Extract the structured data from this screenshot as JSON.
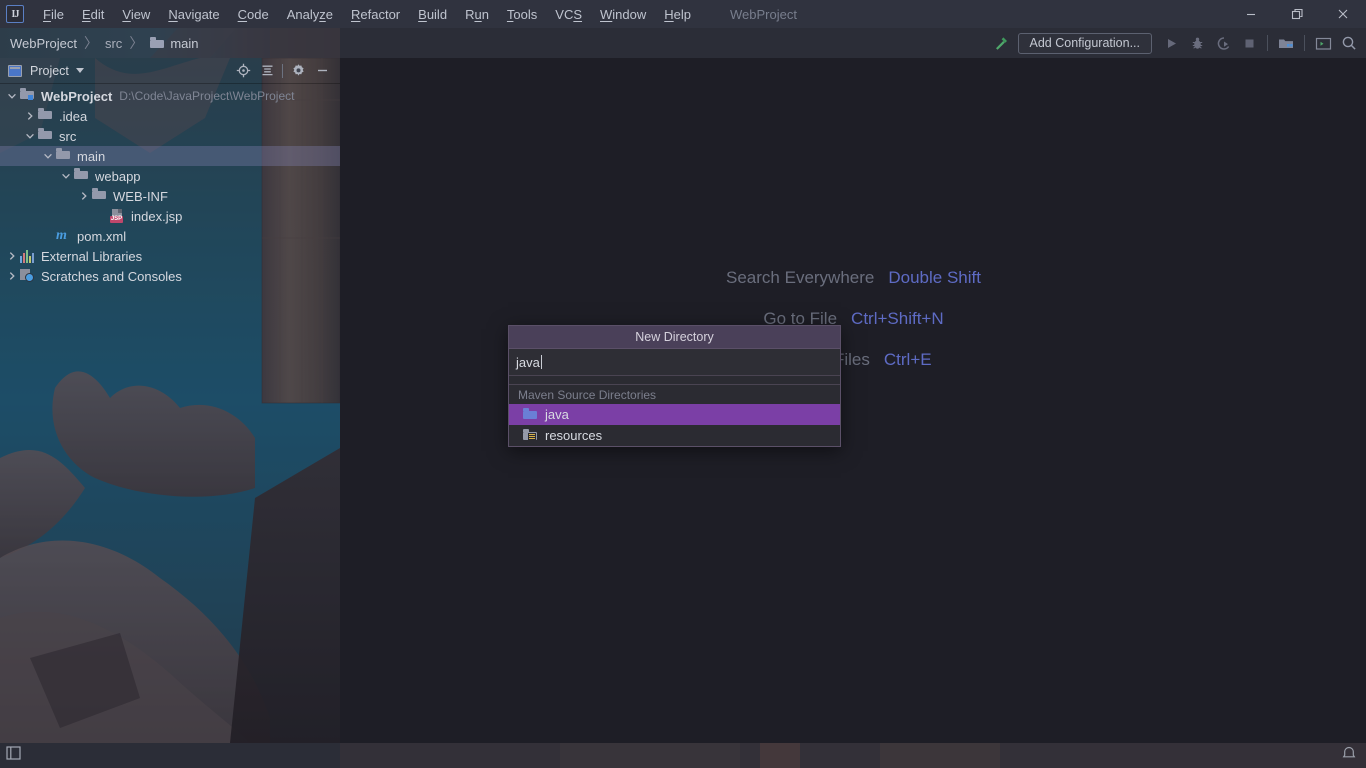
{
  "window": {
    "title": "WebProject",
    "logo_text": "IJ",
    "controls": [
      {
        "name": "minimize-button",
        "icon": "minimize-icon"
      },
      {
        "name": "restore-button",
        "icon": "restore-icon"
      },
      {
        "name": "close-button",
        "icon": "close-icon"
      }
    ]
  },
  "menubar": {
    "items": [
      {
        "label": "File",
        "mnemonic": "F"
      },
      {
        "label": "Edit",
        "mnemonic": "E"
      },
      {
        "label": "View",
        "mnemonic": "V"
      },
      {
        "label": "Navigate",
        "mnemonic": "N"
      },
      {
        "label": "Code",
        "mnemonic": "C"
      },
      {
        "label": "Analyze",
        "mnemonic": "z"
      },
      {
        "label": "Refactor",
        "mnemonic": "R"
      },
      {
        "label": "Build",
        "mnemonic": "B"
      },
      {
        "label": "Run",
        "mnemonic": "u"
      },
      {
        "label": "Tools",
        "mnemonic": "T"
      },
      {
        "label": "VCS",
        "mnemonic": "S"
      },
      {
        "label": "Window",
        "mnemonic": "W"
      },
      {
        "label": "Help",
        "mnemonic": "H"
      }
    ]
  },
  "navbar": {
    "breadcrumb": [
      {
        "label": "WebProject",
        "icon": null
      },
      {
        "label": "src",
        "icon": null
      },
      {
        "label": "main",
        "icon": "folder-icon"
      }
    ],
    "separator": "〉",
    "run_config_label": "Add Configuration...",
    "actions": [
      {
        "name": "build-button",
        "icon": "hammer-icon"
      },
      {
        "name": "run-button",
        "icon": "play-icon"
      },
      {
        "name": "debug-button",
        "icon": "bug-icon"
      },
      {
        "name": "run-with-coverage-button",
        "icon": "coverage-icon"
      },
      {
        "name": "stop-button",
        "icon": "stop-icon"
      },
      {
        "name": "project-structure-button",
        "icon": "project-structure-icon"
      },
      {
        "name": "terminal-button",
        "icon": "terminal-icon"
      },
      {
        "name": "search-everywhere-button",
        "icon": "search-icon"
      }
    ]
  },
  "sidebar": {
    "title": "Project",
    "actions": [
      {
        "name": "select-opened-file-button",
        "icon": "target-icon"
      },
      {
        "name": "collapse-all-button",
        "icon": "collapse-all-icon"
      },
      {
        "name": "settings-button",
        "icon": "gear-icon"
      },
      {
        "name": "hide-button",
        "icon": "minimize-icon"
      }
    ],
    "tree": [
      {
        "label": "WebProject",
        "path": "D:\\Code\\JavaProject\\WebProject",
        "indent": 0,
        "arrow": "down",
        "icon": "project-folder-icon",
        "bold": true,
        "selected": false
      },
      {
        "label": ".idea",
        "path": "",
        "indent": 1,
        "arrow": "right",
        "icon": "folder-icon",
        "bold": false,
        "selected": false
      },
      {
        "label": "src",
        "path": "",
        "indent": 1,
        "arrow": "down",
        "icon": "folder-icon",
        "bold": false,
        "selected": false
      },
      {
        "label": "main",
        "path": "",
        "indent": 2,
        "arrow": "down",
        "icon": "folder-icon",
        "bold": false,
        "selected": true
      },
      {
        "label": "webapp",
        "path": "",
        "indent": 3,
        "arrow": "down",
        "icon": "folder-icon",
        "bold": false,
        "selected": false
      },
      {
        "label": "WEB-INF",
        "path": "",
        "indent": 4,
        "arrow": "right",
        "icon": "folder-icon",
        "bold": false,
        "selected": false
      },
      {
        "label": "index.jsp",
        "path": "",
        "indent": 5,
        "arrow": "none",
        "icon": "jsp-file-icon",
        "bold": false,
        "selected": false
      },
      {
        "label": "pom.xml",
        "path": "",
        "indent": 2,
        "arrow": "none",
        "icon": "maven-icon",
        "bold": false,
        "selected": false
      },
      {
        "label": "External Libraries",
        "path": "",
        "indent": 0,
        "arrow": "right",
        "icon": "libraries-icon",
        "bold": false,
        "selected": false
      },
      {
        "label": "Scratches and Consoles",
        "path": "",
        "indent": 0,
        "arrow": "right",
        "icon": "scratches-icon",
        "bold": false,
        "selected": false
      }
    ]
  },
  "editor": {
    "watermark": [
      {
        "action": "Search Everywhere",
        "shortcut": "Double Shift"
      },
      {
        "action": "Go to File",
        "shortcut": "Ctrl+Shift+N"
      },
      {
        "action": "Recent Files",
        "shortcut": "Ctrl+E"
      }
    ]
  },
  "popup": {
    "title": "New Directory",
    "input_value": "java",
    "group_label": "Maven Source Directories",
    "options": [
      {
        "label": "java",
        "icon": "source-folder-icon",
        "selected": true
      },
      {
        "label": "resources",
        "icon": "resources-folder-icon",
        "selected": false
      }
    ]
  },
  "statusbar": {
    "left_icon": "toggle-tool-windows-icon",
    "right_icon": "notifications-icon"
  },
  "colors": {
    "accent_selection": "#7b3fa6",
    "tree_selection": "#6e6d9c",
    "link": "#5e6bc4",
    "editor_bg": "#1e1e26",
    "chrome_bg": "#30333f"
  }
}
